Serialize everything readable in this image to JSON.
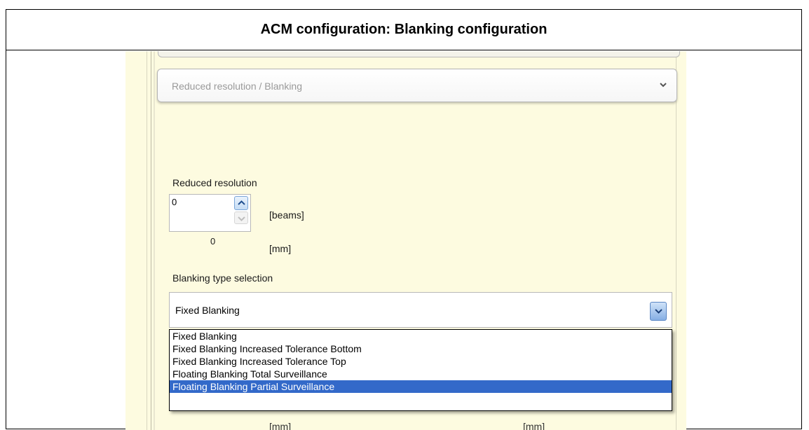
{
  "title": "ACM configuration: Blanking configuration",
  "section": {
    "label": "Reduced resolution / Blanking"
  },
  "reduced_resolution": {
    "label": "Reduced resolution",
    "value": "0",
    "beams_unit": "[beams]",
    "mm_value": "0",
    "mm_unit": "[mm]"
  },
  "blanking": {
    "label": "Blanking type selection",
    "selected": "Fixed Blanking",
    "options": [
      "Fixed Blanking",
      "Fixed Blanking Increased Tolerance Bottom",
      "Fixed Blanking Increased Tolerance Top",
      "Floating Blanking Total Surveillance",
      "Floating Blanking Partial Surveillance"
    ],
    "highlighted_index": 4
  },
  "background_units": [
    "[mm]",
    "[mm]"
  ],
  "colors": {
    "panel_background": "#fdfbe0",
    "highlight": "#3369c9",
    "combo_button": "#86afe4"
  }
}
